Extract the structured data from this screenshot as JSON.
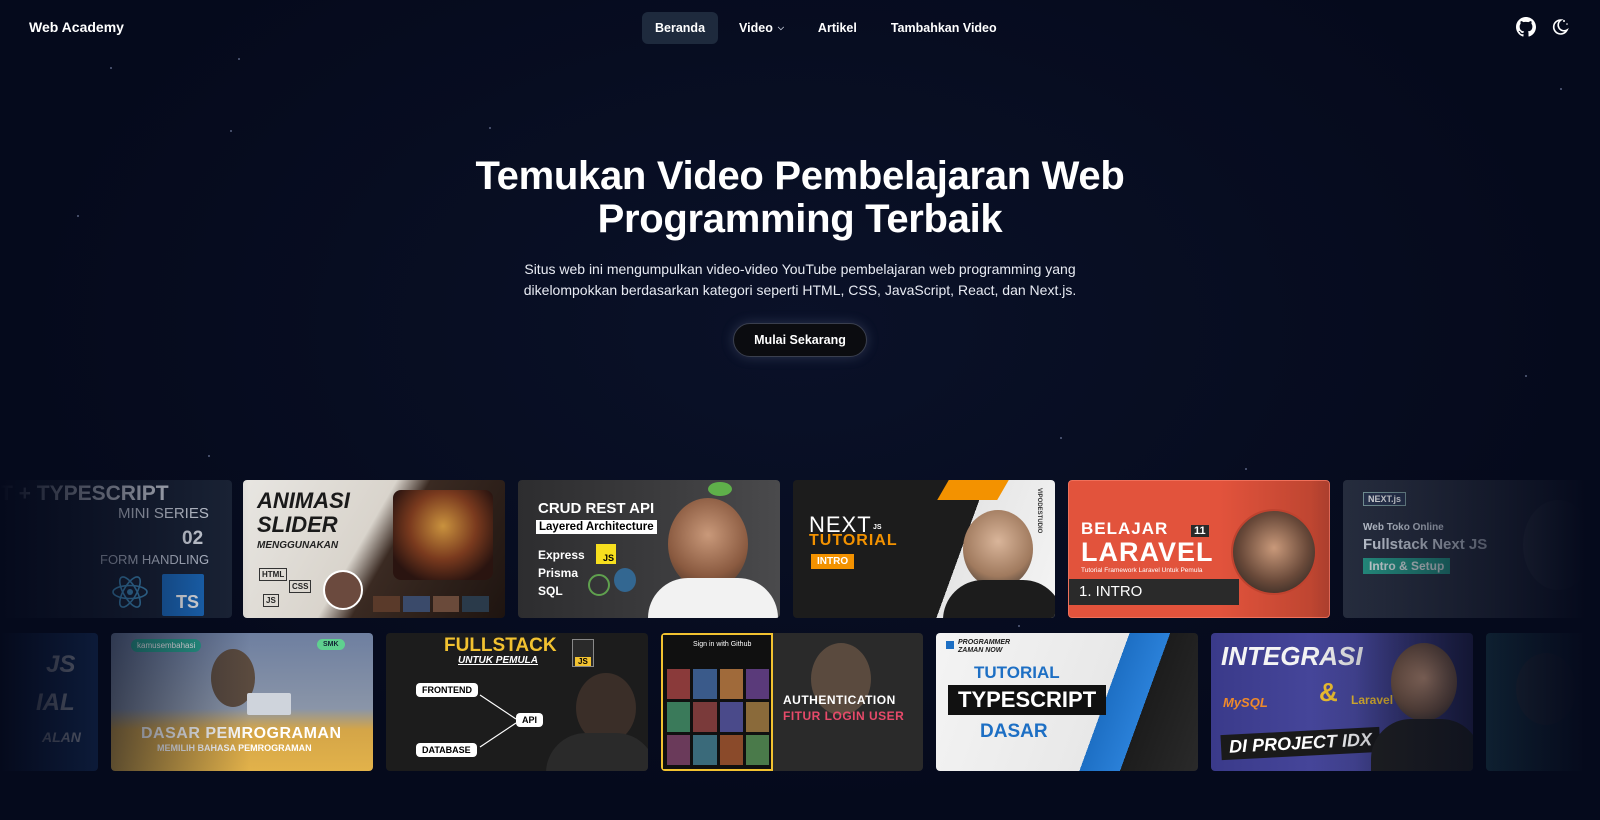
{
  "nav": {
    "brand": "Web Academy",
    "items": [
      {
        "label": "Beranda",
        "active": true
      },
      {
        "label": "Video",
        "has_dropdown": true
      },
      {
        "label": "Artikel"
      },
      {
        "label": "Tambahkan Video"
      }
    ],
    "icons": [
      "github-icon",
      "theme-toggle-icon"
    ]
  },
  "hero": {
    "title": "Temukan Video Pembelajaran Web Programming Terbaik",
    "description": "Situs web ini mengumpulkan video-video YouTube pembelajaran web programming yang dikelompokkan berdasarkan kategori seperti HTML, CSS, JavaScript, React, dan Next.js.",
    "cta_label": "Mulai Sekarang"
  },
  "row1": {
    "t0": {
      "line1": "T + TYPESCRIPT",
      "line2": "MINI SERIES",
      "num": "02",
      "sub": "FORM HANDLING",
      "badge": "TS"
    },
    "t1": {
      "line1": "ANIMASI",
      "line2": "SLIDER",
      "sub": "MENGGUNAKAN",
      "b1": "HTML",
      "b2": "CSS",
      "b3": "JS"
    },
    "t2": {
      "line1": "CRUD REST API",
      "line2": "Layered Architecture",
      "l3": "Express",
      "l4": "Prisma",
      "l5": "SQL",
      "badge": "JS"
    },
    "t3": {
      "line1": "NEXT",
      "js": "JS",
      "line2": "TUTORIAL",
      "tag": "INTRO",
      "side": "VIPODESTUDIO"
    },
    "t4": {
      "line1": "BELAJAR",
      "line2": "LARAVEL",
      "num": "11",
      "sub": "Tutorial Framework Laravel Untuk Pemula",
      "bottom": "1. INTRO"
    },
    "t5": {
      "logo": "NEXT.js",
      "line1": "Web Toko Online",
      "line2": "Fullstack Next JS",
      "tag": "Intro & Setup"
    }
  },
  "row2": {
    "t0": {
      "line1": "JS",
      "line2": "IAL",
      "line3": "ALAN"
    },
    "t1": {
      "badge": "kamusembahasi",
      "tag": "SMK",
      "line1": "DASAR PEMROGRAMAN",
      "line2": "MEMILIH BAHASA PEMROGRAMAN"
    },
    "t2": {
      "line1": "FULLSTACK",
      "line2": "UNTUK PEMULA",
      "badge": "JS",
      "n1": "FRONTEND",
      "n2": "API",
      "n3": "DATABASE"
    },
    "t3": {
      "header": "Sign in with Github",
      "line1": "AUTHENTICATION",
      "line2": "FITUR LOGIN USER"
    },
    "t4": {
      "brand": "PROGRAMMER ZAMAN NOW",
      "line1": "TUTORIAL",
      "line2": "TYPESCRIPT",
      "line3": "DASAR"
    },
    "t5": {
      "line1": "INTEGRASI",
      "amp": "&",
      "mysql": "MySQL",
      "laravel": "Laravel",
      "line2": "DI PROJECT IDX"
    }
  },
  "colors": {
    "background": "#050a1c",
    "nav_active": "#1e2a3d",
    "laravel_red": "#e2533c",
    "nextjs_orange": "#f39200",
    "typescript_blue": "#1d6fc4"
  }
}
